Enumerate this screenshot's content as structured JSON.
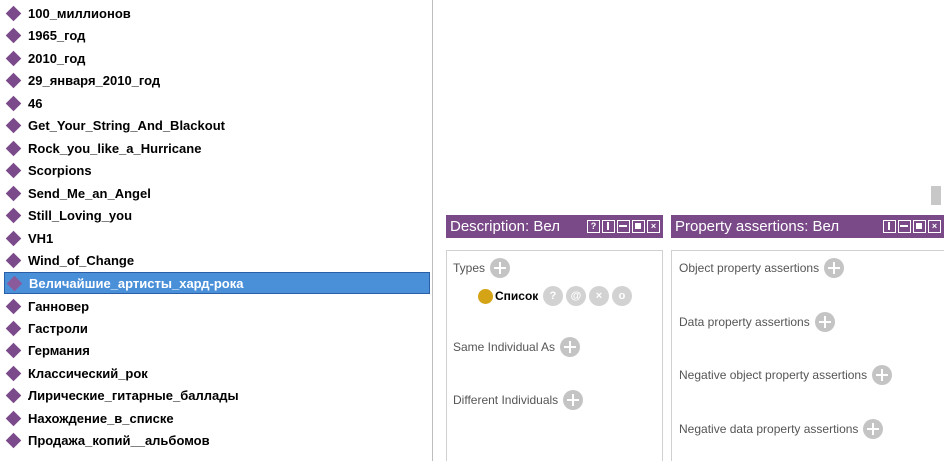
{
  "individuals": [
    {
      "label": "100_миллионов",
      "selected": false
    },
    {
      "label": "1965_год",
      "selected": false
    },
    {
      "label": "2010_год",
      "selected": false
    },
    {
      "label": "29_января_2010_год",
      "selected": false
    },
    {
      "label": "46",
      "selected": false
    },
    {
      "label": "Get_Your_String_And_Blackout",
      "selected": false
    },
    {
      "label": "Rock_you_like_a_Hurricane",
      "selected": false
    },
    {
      "label": "Scorpions",
      "selected": false
    },
    {
      "label": "Send_Me_an_Angel",
      "selected": false
    },
    {
      "label": "Still_Loving_you",
      "selected": false
    },
    {
      "label": "VH1",
      "selected": false
    },
    {
      "label": "Wind_of_Change",
      "selected": false
    },
    {
      "label": "Величайшие_артисты_хард-рока",
      "selected": true
    },
    {
      "label": "Ганновер",
      "selected": false
    },
    {
      "label": "Гастроли",
      "selected": false
    },
    {
      "label": "Германия",
      "selected": false
    },
    {
      "label": "Классический_рок",
      "selected": false
    },
    {
      "label": "Лирические_гитарные_баллады",
      "selected": false
    },
    {
      "label": "Нахождение_в_списке",
      "selected": false
    },
    {
      "label": "Продажа_копий__альбомов",
      "selected": false
    }
  ],
  "description_view": {
    "title": "Description: Вел",
    "sections": {
      "types": "Types",
      "same_individual": "Same Individual As",
      "different_individuals": "Different Individuals"
    },
    "type_entry": {
      "label": "Список",
      "actions": [
        "?",
        "@",
        "×",
        "o"
      ]
    }
  },
  "property_view": {
    "title": "Property assertions: Вел",
    "sections": {
      "object": "Object property assertions",
      "data": "Data property assertions",
      "negative_object": "Negative object property assertions",
      "negative_data": "Negative data property assertions"
    }
  },
  "colors": {
    "header_bg": "#7a4a88",
    "selection_bg": "#4a90d9",
    "individual_icon": "#7a4a8a",
    "class_icon": "#d4a316"
  }
}
